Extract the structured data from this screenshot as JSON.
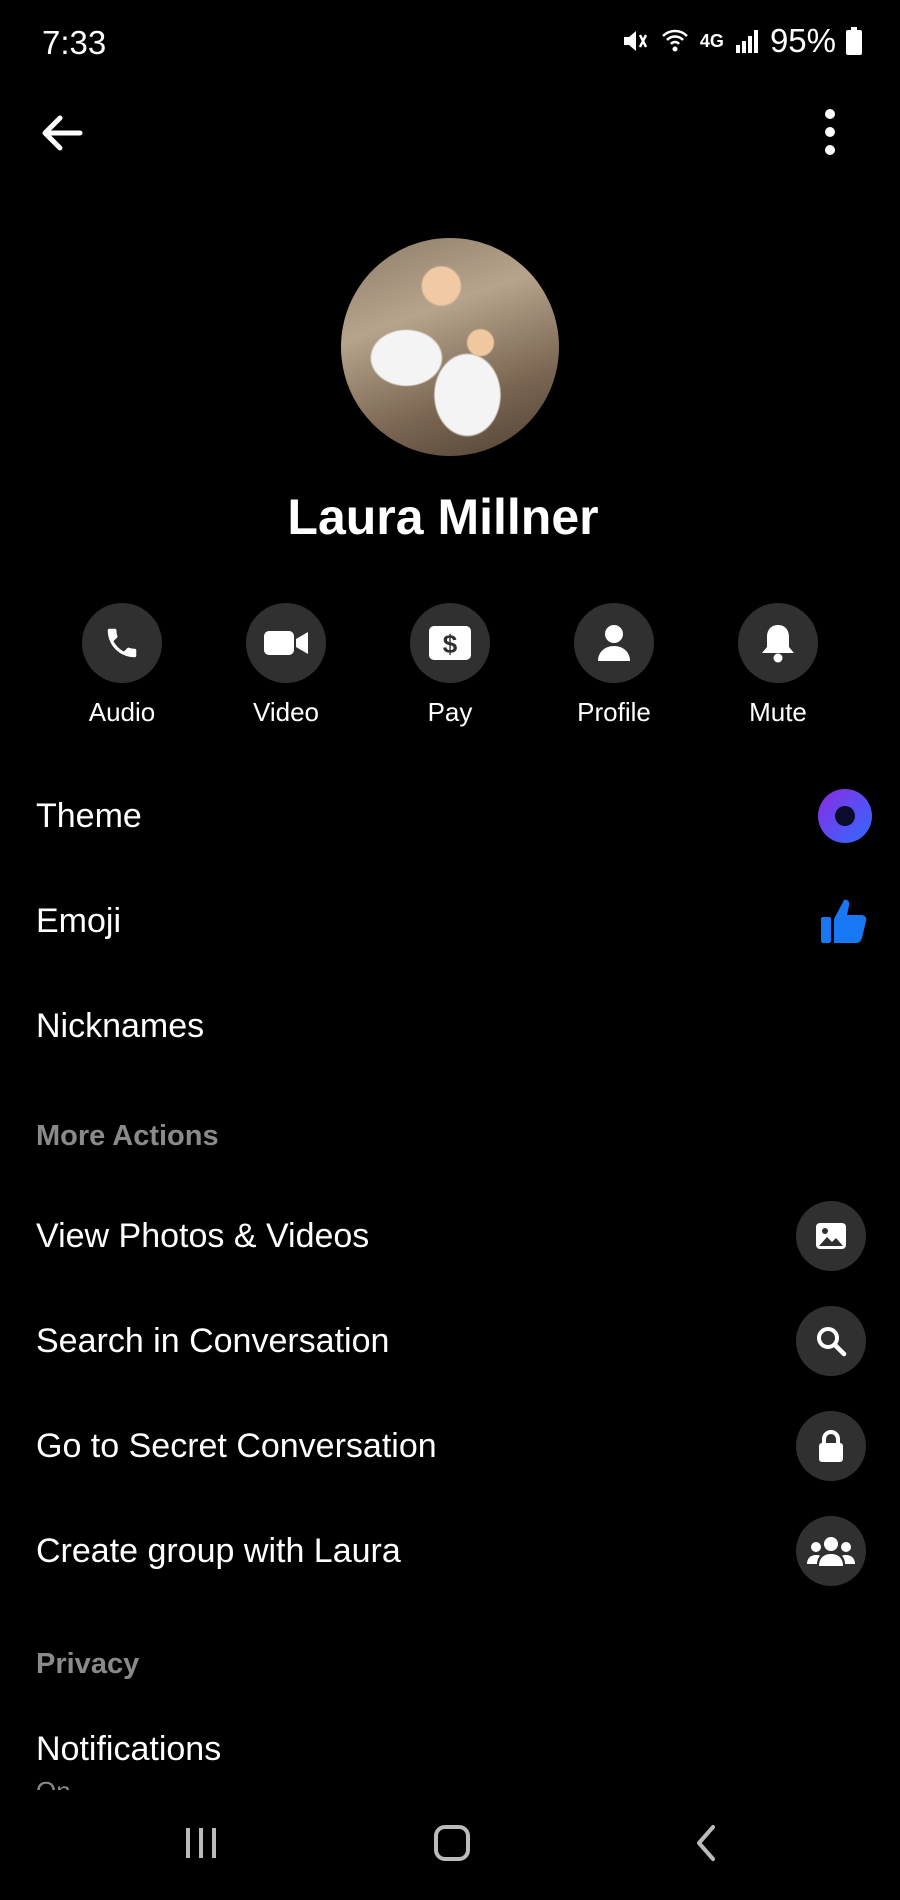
{
  "status": {
    "time": "7:33",
    "network": "4G",
    "battery": "95%"
  },
  "contact": {
    "name": "Laura Millner"
  },
  "actions": [
    {
      "label": "Audio",
      "icon": "phone-icon"
    },
    {
      "label": "Video",
      "icon": "video-camera-icon"
    },
    {
      "label": "Pay",
      "icon": "dollar-icon"
    },
    {
      "label": "Profile",
      "icon": "person-icon"
    },
    {
      "label": "Mute",
      "icon": "bell-icon"
    }
  ],
  "customize": [
    {
      "label": "Theme",
      "icon": "theme-ring-icon"
    },
    {
      "label": "Emoji",
      "icon": "thumbs-up-icon"
    },
    {
      "label": "Nicknames"
    }
  ],
  "more_actions": {
    "title": "More Actions",
    "items": [
      {
        "label": "View Photos & Videos",
        "icon": "image-icon"
      },
      {
        "label": "Search in Conversation",
        "icon": "search-icon"
      },
      {
        "label": "Go to Secret Conversation",
        "icon": "lock-icon"
      },
      {
        "label": "Create group with Laura",
        "icon": "group-icon"
      }
    ]
  },
  "privacy": {
    "title": "Privacy",
    "notifications_label": "Notifications",
    "notifications_value": "On"
  },
  "colors": {
    "theme_gradient_start": "#8a2be2",
    "theme_gradient_end": "#2f6bff",
    "emoji_blue": "#1877f2",
    "icon_bg": "#303030"
  }
}
